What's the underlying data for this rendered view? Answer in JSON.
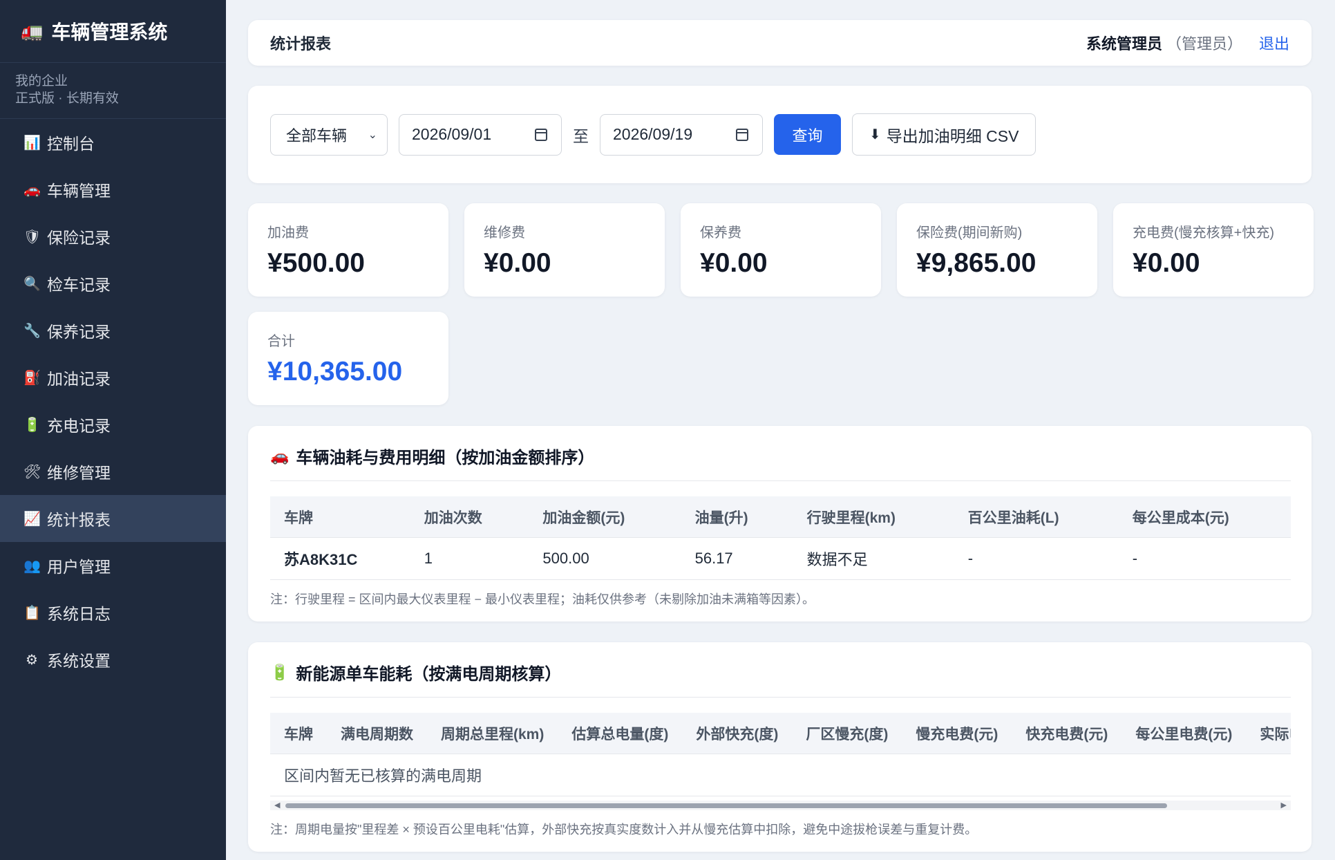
{
  "app": {
    "icon": "truck-icon",
    "title": "车辆管理系统"
  },
  "org": {
    "name": "我的企业",
    "plan": "正式版 · 长期有效"
  },
  "nav": [
    {
      "icon": "chart-icon",
      "glyph": "📊",
      "label": "控制台"
    },
    {
      "icon": "car-icon",
      "glyph": "🚗",
      "label": "车辆管理"
    },
    {
      "icon": "shield-icon",
      "glyph": "🛡",
      "label": "保险记录"
    },
    {
      "icon": "magnifier-icon",
      "glyph": "🔍",
      "label": "检车记录"
    },
    {
      "icon": "wrench-icon",
      "glyph": "🔧",
      "label": "保养记录"
    },
    {
      "icon": "fuel-icon",
      "glyph": "⛽",
      "label": "加油记录"
    },
    {
      "icon": "battery-icon",
      "glyph": "🔋",
      "label": "充电记录"
    },
    {
      "icon": "tools-icon",
      "glyph": "🛠",
      "label": "维修管理"
    },
    {
      "icon": "trend-icon",
      "glyph": "📈",
      "label": "统计报表",
      "active": true
    },
    {
      "icon": "users-icon",
      "glyph": "👥",
      "label": "用户管理"
    },
    {
      "icon": "clipboard-icon",
      "glyph": "📋",
      "label": "系统日志"
    },
    {
      "icon": "gear-icon",
      "glyph": "⚙",
      "label": "系统设置"
    }
  ],
  "header": {
    "title": "统计报表",
    "user": "系统管理员",
    "role": "（管理员）",
    "logout": "退出"
  },
  "filters": {
    "vehicle": "全部车辆",
    "start_date": "2026/09/01",
    "sep": "至",
    "end_date": "2026/09/19",
    "query_label": "查询",
    "export_label": "导出加油明细 CSV"
  },
  "stats": [
    {
      "label": "加油费",
      "value": "¥500.00"
    },
    {
      "label": "维修费",
      "value": "¥0.00"
    },
    {
      "label": "保养费",
      "value": "¥0.00"
    },
    {
      "label": "保险费(期间新购)",
      "value": "¥9,865.00"
    },
    {
      "label": "充电费(慢充核算+快充)",
      "value": "¥0.00"
    },
    {
      "label": "合计",
      "value": "¥10,365.00"
    }
  ],
  "fuel_section": {
    "title": "车辆油耗与费用明细（按加油金额排序）",
    "headers": [
      "车牌",
      "加油次数",
      "加油金额(元)",
      "油量(升)",
      "行驶里程(km)",
      "百公里油耗(L)",
      "每公里成本(元)"
    ],
    "rows": [
      [
        "苏A8K31C",
        "1",
        "500.00",
        "56.17",
        "数据不足",
        "-",
        "-"
      ]
    ],
    "note": "注：行驶里程 = 区间内最大仪表里程 − 最小仪表里程；油耗仅供参考（未剔除加油未满箱等因素）。"
  },
  "ev_section": {
    "title": "新能源单车能耗（按满电周期核算）",
    "headers": [
      "车牌",
      "满电周期数",
      "周期总里程(km)",
      "估算总电量(度)",
      "外部快充(度)",
      "厂区慢充(度)",
      "慢充电费(元)",
      "快充电费(元)",
      "每公里电费(元)",
      "实际电耗"
    ],
    "empty": "区间内暂无已核算的满电周期",
    "note": "注：周期电量按\"里程差 × 预设百公里电耗\"估算，外部快充按真实度数计入并从慢充估算中扣除，避免中途拔枪误差与重复计费。"
  },
  "colors": {
    "sidebar": "#1f2a3d",
    "accent": "#2563eb",
    "background": "#eef2f7"
  }
}
